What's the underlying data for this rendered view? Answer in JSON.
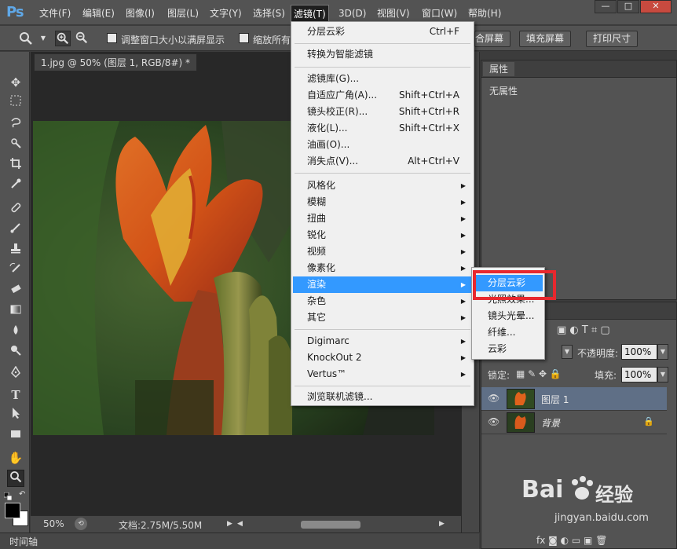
{
  "app": {
    "logo": "Ps"
  },
  "menubar": {
    "items": [
      "文件(F)",
      "编辑(E)",
      "图像(I)",
      "图层(L)",
      "文字(Y)",
      "选择(S)",
      "滤镜(T)",
      "3D(D)",
      "视图(V)",
      "窗口(W)",
      "帮助(H)"
    ],
    "window_buttons": [
      "—",
      "□",
      "✕"
    ]
  },
  "options": {
    "check1_label": "调整窗口大小以满屏显示",
    "check2_label": "缩放所有",
    "fill_screen_partial": "合屏幕",
    "fill_screen": "填充屏幕",
    "print_size": "打印尺寸"
  },
  "document": {
    "tab_title": "1.jpg @ 50% (图层 1, RGB/8#) *",
    "zoom": "50%",
    "doc_info": "文档:2.75M/5.50M"
  },
  "timeline": {
    "label": "时间轴"
  },
  "properties": {
    "tab": "属性",
    "empty": "无属性"
  },
  "layers": {
    "opacity_label": "不透明度:",
    "opacity_value": "100%",
    "lock_label": "锁定:",
    "fill_label": "填充:",
    "fill_value": "100%",
    "rows": [
      {
        "name": "图层 1",
        "selected": true
      },
      {
        "name": "背景",
        "selected": false
      }
    ]
  },
  "filter_menu": {
    "last_filter": "分层云彩",
    "last_filter_shortcut": "Ctrl+F",
    "smart": "转换为智能滤镜",
    "gallery": "滤镜库(G)...",
    "adaptive": "自适应广角(A)...",
    "adaptive_shortcut": "Shift+Ctrl+A",
    "lens": "镜头校正(R)...",
    "lens_shortcut": "Shift+Ctrl+R",
    "liquify": "液化(L)...",
    "liquify_shortcut": "Shift+Ctrl+X",
    "oil": "油画(O)...",
    "vanish": "消失点(V)...",
    "vanish_shortcut": "Alt+Ctrl+V",
    "stylize": "风格化",
    "blur": "模糊",
    "distort": "扭曲",
    "sharpen": "锐化",
    "video": "视频",
    "pixelate": "像素化",
    "render": "渲染",
    "noise": "杂色",
    "other": "其它",
    "digimarc": "Digimarc",
    "knockout": "KnockOut 2",
    "vertus": "Vertus™",
    "browse": "浏览联机滤镜..."
  },
  "render_submenu": {
    "items": [
      "分层云彩",
      "光照效果...",
      "镜头光晕...",
      "纤维...",
      "云彩"
    ]
  },
  "watermark": {
    "brand": "Bai",
    "brand2": "经验",
    "url": "jingyan.baidu.com"
  },
  "colors": {
    "highlight": "#3399ff",
    "callout": "#e8282e"
  }
}
